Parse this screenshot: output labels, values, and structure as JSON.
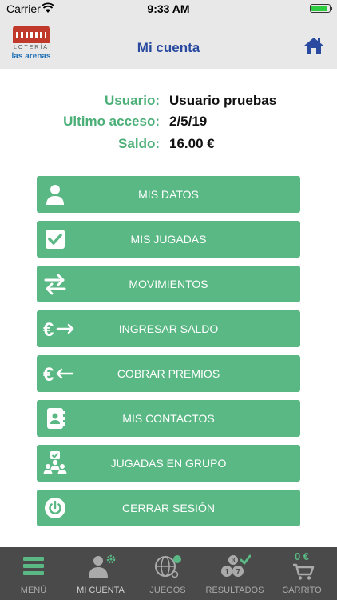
{
  "status_bar": {
    "carrier": "Carrier",
    "time": "9:33 AM"
  },
  "nav": {
    "logo_line1": "LOTERÍA",
    "logo_line2": "las arenas",
    "title": "Mi cuenta"
  },
  "account": [
    {
      "label": "Usuario:",
      "value": "Usuario pruebas"
    },
    {
      "label": "Ultimo acceso:",
      "value": "2/5/19"
    },
    {
      "label": "Saldo:",
      "value": "16.00 €"
    }
  ],
  "menu": [
    {
      "label": "MIS DATOS",
      "icon": "user-icon"
    },
    {
      "label": "MIS JUGADAS",
      "icon": "checkbox-icon"
    },
    {
      "label": "MOVIMIENTOS",
      "icon": "transfer-arrows-icon"
    },
    {
      "label": "INGRESAR SALDO",
      "icon": "euro-arrow-right-icon"
    },
    {
      "label": "COBRAR PREMIOS",
      "icon": "euro-arrow-left-icon"
    },
    {
      "label": "MIS CONTACTOS",
      "icon": "address-book-icon"
    },
    {
      "label": "JUGADAS EN GRUPO",
      "icon": "group-icon"
    },
    {
      "label": "CERRAR SESIÓN",
      "icon": "power-icon"
    }
  ],
  "tabs": [
    {
      "label": "MENÚ",
      "icon": "hamburger-menu-icon"
    },
    {
      "label": "MI CUENTA",
      "icon": "user-settings-icon"
    },
    {
      "label": "JUEGOS",
      "icon": "lottery-globe-icon"
    },
    {
      "label": "RESULTADOS",
      "icon": "lottery-balls-icon"
    },
    {
      "label": "CARRITO",
      "icon": "cart-icon",
      "total": "0 €"
    }
  ],
  "colors": {
    "accent_green": "#5ab884",
    "title_blue": "#2a4aa0",
    "tab_bg": "#4a4a4a"
  }
}
